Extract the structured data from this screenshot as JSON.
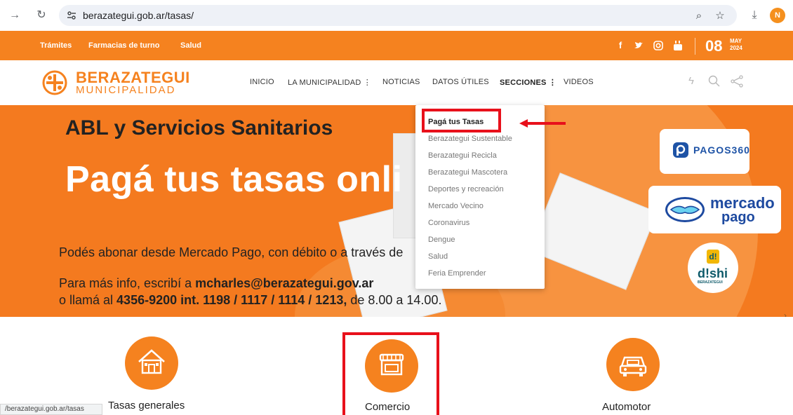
{
  "browser": {
    "url": "berazategui.gob.ar/tasas/",
    "avatar_initial": "N",
    "status_url": "/berazategui.gob.ar/tasas"
  },
  "topbar": {
    "links": [
      "Trámites",
      "Farmacias de turno",
      "Salud"
    ],
    "date_day": "08",
    "date_month": "MAY",
    "date_year": "2024"
  },
  "logo": {
    "line1": "BERAZATEGUI",
    "line2": "MUNICIPALIDAD"
  },
  "nav": {
    "inicio": "INICIO",
    "municipalidad": "LA MUNICIPALIDAD",
    "noticias": "NOTICIAS",
    "datos": "DATOS ÚTILES",
    "secciones": "SECCIONES",
    "videos": "VIDEOS"
  },
  "hero": {
    "title1": "ABL y Servicios Sanitarios",
    "title2": "Pagá tus tasas onli",
    "line1": "Podés abonar desde Mercado Pago, con débito o a través de",
    "line2_pre": "Para más info, escribí a ",
    "line2_email": "mcharles@berazategui.gov.ar",
    "line3_pre": "o llamá al ",
    "line3_phone": "4356-9200 int. 1198 / 1117 / 1114 / 1213,",
    "line3_post": " de 8.00 a 14.00.",
    "pagos": "PAGOS360",
    "mp1": "mercado",
    "mp2": "pago",
    "dishi": "d!shi",
    "dishi_sub": "BERAZATEGUI",
    "dishi_d": "d!"
  },
  "dropdown": {
    "items": [
      "Pagá tus Tasas",
      "Berazategui Sustentable",
      "Berazategui Recicla",
      "Berazategui Mascotera",
      "Deportes y recreación",
      "Mercado Vecino",
      "Coronavirus",
      "Dengue",
      "Salud",
      "Feria Emprender"
    ]
  },
  "categories": {
    "tasas": "Tasas generales",
    "comercio": "Comercio",
    "automotor": "Automotor"
  },
  "colors": {
    "brand_orange": "#f5821f",
    "highlight_red": "#e8101b"
  }
}
